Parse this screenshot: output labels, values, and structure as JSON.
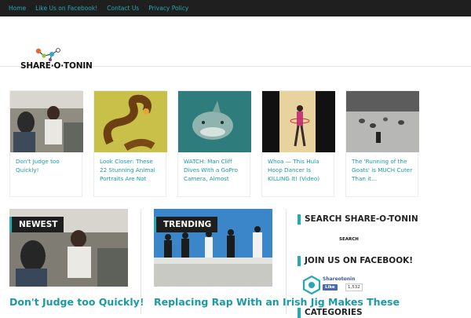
{
  "colors": {
    "accent": "#22aab5",
    "nav_bg": "#1f1f1f",
    "link": "#1a9aa7"
  },
  "nav": [
    {
      "label": "Home"
    },
    {
      "label": "Like Us on Facebook!"
    },
    {
      "label": "Contact Us"
    },
    {
      "label": "Privacy Policy"
    }
  ],
  "logo": {
    "text": "SHARE·O·TONIN"
  },
  "cards": [
    {
      "caption": "Don't Judge too Quickly!",
      "icon": "airplane-cabin-photo"
    },
    {
      "caption": "Look Closer: These 22 Stunning Animal Portraits Are Not",
      "icon": "snake-photo"
    },
    {
      "caption": "WATCH: Man Cliff Dives With a GoPro Camera, Almost",
      "icon": "shark-photo"
    },
    {
      "caption": "Whoa — This Hula Hoop Dancer Is KILLING It! (Video)",
      "icon": "hula-dancer-photo"
    },
    {
      "caption": "The 'Running of the Goats' is MUCH Cuter Than it…",
      "icon": "goats-photo"
    }
  ],
  "featured": [
    {
      "badge": "NEWEST",
      "title": "Don't Judge too Quickly!"
    },
    {
      "badge": "TRENDING",
      "title": "Replacing Rap With an Irish Jig Makes These"
    }
  ],
  "sidebar": {
    "search_heading": "SEARCH SHARE-O-TONIN",
    "search_button": "SEARCH",
    "facebook_heading": "JOIN US ON FACEBOOK!",
    "fb_name": "Shareotonin",
    "fb_like": "Like",
    "fb_count": "1,532",
    "categories_heading": "CATEGORIES"
  }
}
